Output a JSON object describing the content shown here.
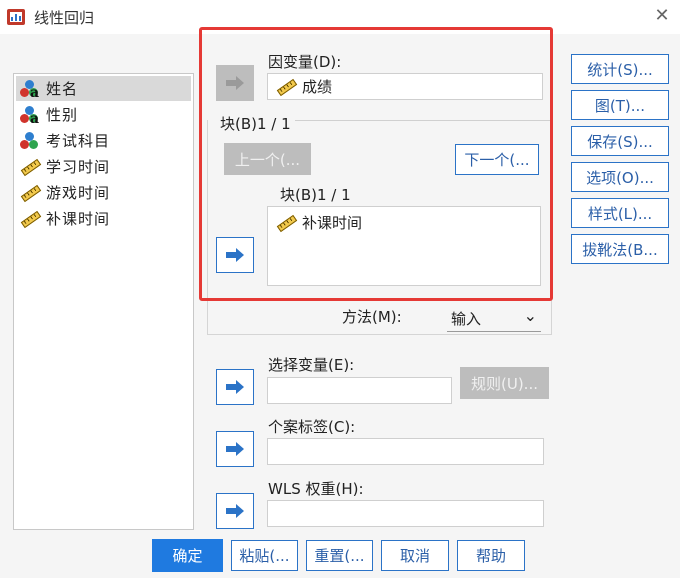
{
  "window": {
    "title": "线性回归",
    "close_glyph": "✕"
  },
  "variables": [
    {
      "label": "姓名",
      "type": "nominal",
      "selected": true
    },
    {
      "label": "性别",
      "type": "nominal",
      "selected": false
    },
    {
      "label": "考试科目",
      "type": "nominal",
      "selected": false
    },
    {
      "label": "学习时间",
      "type": "scale",
      "selected": false
    },
    {
      "label": "游戏时间",
      "type": "scale",
      "selected": false
    },
    {
      "label": "补课时间",
      "type": "scale",
      "selected": false
    }
  ],
  "dependent": {
    "label": "因变量(D):",
    "value": "成绩"
  },
  "block": {
    "group_label": "块(B)1 / 1",
    "prev_label": "上一个(...",
    "next_label": "下一个(...",
    "inner_label": "块(B)1 / 1",
    "items": [
      "补课时间"
    ]
  },
  "method": {
    "label": "方法(M):",
    "value": "输入",
    "chevron": "⌄"
  },
  "selection": {
    "label": "选择变量(E):",
    "value": "",
    "rule_label": "规则(U)..."
  },
  "case_label": {
    "label": "个案标签(C):",
    "value": ""
  },
  "wls": {
    "label": "WLS 权重(H):",
    "value": ""
  },
  "side_buttons": [
    "统计(S)...",
    "图(T)...",
    "保存(S)...",
    "选项(O)...",
    "样式(L)...",
    "拔靴法(B..."
  ],
  "bottom_buttons": {
    "ok": "确定",
    "paste": "粘贴(...",
    "reset": "重置(...",
    "cancel": "取消",
    "help": "帮助"
  },
  "colors": {
    "accent": "#2b73c7",
    "primary": "#1f7ae0",
    "highlight": "#e53935",
    "disabled": "#bdbdbd"
  }
}
